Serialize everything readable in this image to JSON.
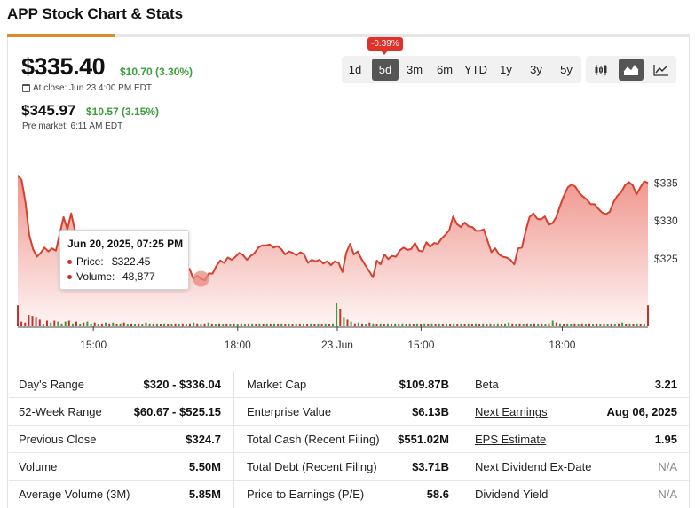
{
  "page": {
    "title": "APP Stock Chart & Stats"
  },
  "quote": {
    "price": "$335.40",
    "change": "$10.70 (3.30%)",
    "close_label": "At close: Jun 23 4:00 PM EDT",
    "pre_price": "$345.97",
    "pre_change": "$10.57 (3.15%)",
    "pre_label": "Pre market: 6:11 AM EDT"
  },
  "range_tabs": [
    {
      "label": "1d",
      "active": false
    },
    {
      "label": "5d",
      "active": true
    },
    {
      "label": "3m",
      "active": false
    },
    {
      "label": "6m",
      "active": false
    },
    {
      "label": "YTD",
      "active": false
    },
    {
      "label": "1y",
      "active": false
    },
    {
      "label": "3y",
      "active": false
    },
    {
      "label": "5y",
      "active": false
    }
  ],
  "range_badge": "-0.39%",
  "chart_types": [
    {
      "icon": "candlestick-icon",
      "active": false
    },
    {
      "icon": "area-chart-icon",
      "active": true
    },
    {
      "icon": "line-chart-icon",
      "active": false
    }
  ],
  "chart_data": {
    "type": "area",
    "colors": {
      "line": "#d6402f",
      "fill": "#e65345",
      "volume_up": "#3a9b3a",
      "volume_down": "#c9302c"
    },
    "ylim": [
      318.5,
      336.2
    ],
    "y_ticks": [
      325,
      330,
      335
    ],
    "y_tick_labels": [
      "$325",
      "$330",
      "$335"
    ],
    "x_tick_labels": [
      "15:00",
      "18:00",
      "23 Jun",
      "15:00",
      "18:00"
    ],
    "x_tick_positions": [
      0.12,
      0.349,
      0.507,
      0.64,
      0.864
    ],
    "grid": false,
    "price": [
      336.0,
      335.4,
      332.5,
      328.2,
      326.3,
      325.3,
      325.8,
      326.5,
      326.0,
      326.4,
      326.1,
      328.3,
      330.5,
      328.9,
      331.0,
      328.7,
      325.7,
      325.3,
      325.2,
      325.1,
      324.9,
      325.6,
      325.4,
      325.5,
      324.6,
      325.8,
      323.7,
      324.7,
      324.8,
      323.6,
      325.3,
      323.6,
      323.3,
      324.6,
      323.8,
      323.3,
      324.4,
      323.8,
      323.0,
      323.9,
      324.4,
      323.7,
      323.3,
      323.9,
      323.3,
      323.7,
      322.4,
      322.8,
      322.4,
      322.2,
      323.1,
      323.1,
      324.1,
      324.8,
      324.5,
      325.2,
      324.9,
      325.3,
      325.8,
      325.5,
      324.9,
      325.4,
      325.8,
      326.5,
      326.8,
      326.8,
      326.9,
      326.5,
      326.7,
      326.3,
      325.6,
      326.0,
      325.8,
      325.5,
      325.9,
      325.6,
      324.5,
      324.9,
      324.7,
      324.9,
      324.4,
      324.7,
      324.2,
      324.7,
      324.5,
      323.3,
      325.8,
      327.0,
      325.6,
      326.0,
      325.0,
      324.2,
      323.4,
      322.6,
      324.8,
      324.3,
      325.6,
      325.0,
      325.4,
      325.3,
      326.1,
      326.5,
      326.2,
      326.3,
      327.1,
      326.1,
      326.0,
      327.2,
      326.6,
      327.1,
      327.0,
      327.7,
      328.2,
      328.8,
      330.6,
      329.6,
      329.2,
      329.8,
      329.3,
      329.2,
      328.7,
      328.7,
      328.9,
      327.4,
      325.9,
      326.4,
      325.6,
      325.3,
      325.2,
      324.9,
      324.3,
      326.4,
      326.5,
      328.7,
      330.5,
      331.0,
      330.3,
      330.2,
      330.6,
      329.5,
      329.7,
      330.5,
      332.0,
      333.3,
      334.4,
      334.8,
      334.5,
      333.7,
      333.2,
      332.8,
      332.2,
      332.2,
      331.6,
      331.1,
      330.9,
      331.2,
      332.5,
      333.3,
      333.8,
      334.7,
      335.1,
      334.7,
      333.5,
      334.4,
      335.2,
      335.0
    ],
    "volume": [
      22,
      5,
      4,
      12,
      11,
      9,
      7,
      2,
      6,
      4,
      6,
      5,
      3,
      5,
      6,
      3,
      5,
      2,
      4,
      5,
      3,
      4,
      2,
      3,
      4,
      3,
      4,
      2,
      3,
      4,
      2,
      3,
      2,
      3,
      2,
      4,
      3,
      2,
      3,
      2,
      3,
      2,
      2,
      3,
      2,
      3,
      2,
      3,
      4,
      3,
      2,
      3,
      4,
      3,
      2,
      3,
      2,
      3,
      2,
      3,
      2,
      3,
      2,
      3,
      3,
      2,
      3,
      2,
      3,
      2,
      3,
      2,
      3,
      2,
      3,
      2,
      3,
      2,
      3,
      2,
      3,
      2,
      3,
      2,
      3,
      2,
      3,
      24,
      18,
      9,
      7,
      5,
      3,
      4,
      3,
      2,
      4,
      3,
      2,
      3,
      2,
      3,
      2,
      3,
      2,
      3,
      2,
      3,
      2,
      3,
      2,
      3,
      2,
      3,
      2,
      3,
      2,
      3,
      2,
      3,
      2,
      3,
      2,
      3,
      2,
      3,
      2,
      3,
      2,
      3,
      2,
      3,
      2,
      3,
      4,
      3,
      2,
      3,
      2,
      3,
      2,
      3,
      2,
      3,
      2,
      3,
      6,
      4,
      3,
      2,
      3,
      2,
      3,
      2,
      3,
      2,
      3,
      2,
      3,
      2,
      3,
      2,
      3,
      2,
      3,
      4,
      2,
      3,
      2,
      3,
      2,
      3,
      22
    ],
    "volume_up": [
      false,
      false,
      false,
      false,
      false,
      false,
      false,
      true,
      false,
      true,
      false,
      true,
      true,
      true,
      false,
      true,
      false,
      true,
      false,
      true,
      true,
      false,
      true,
      false,
      true,
      false,
      true,
      false,
      true,
      false,
      true,
      false,
      true,
      false,
      true,
      false,
      true,
      false,
      true,
      false,
      true,
      false,
      true,
      false,
      true,
      false,
      true,
      false,
      true,
      false,
      true,
      false,
      true,
      false,
      true,
      false,
      true,
      false,
      true,
      false,
      true,
      false,
      true,
      false,
      true,
      false,
      true,
      false,
      true,
      false,
      true,
      false,
      true,
      false,
      true,
      false,
      true,
      false,
      true,
      false,
      true,
      false,
      true,
      false,
      true,
      false,
      true,
      true,
      false,
      true,
      false,
      true,
      false,
      true,
      false,
      true,
      false,
      true,
      false,
      true,
      false,
      true,
      false,
      true,
      false,
      true,
      false,
      true,
      false,
      true,
      false,
      true,
      false,
      true,
      false,
      true,
      false,
      true,
      false,
      true,
      false,
      true,
      false,
      true,
      false,
      true,
      false,
      true,
      false,
      true,
      false,
      true,
      false,
      true,
      true,
      false,
      true,
      false,
      true,
      false,
      true,
      false,
      true,
      false,
      true,
      false,
      true,
      false,
      true,
      false,
      true,
      true,
      false,
      true,
      false,
      true,
      false,
      true,
      false,
      true,
      false,
      true,
      false,
      true,
      false,
      true,
      false,
      true,
      false,
      true,
      false,
      true,
      false,
      true,
      true
    ],
    "highlight_index": 48,
    "tooltip": {
      "date": "Jun 20, 2025, 07:25 PM",
      "price_label": "Price:",
      "price": "$322.45",
      "volume_label": "Volume:",
      "volume": "48,877"
    }
  },
  "stats": {
    "col1": [
      {
        "label": "Day's Range",
        "value": "$320 - $336.04"
      },
      {
        "label": "52-Week Range",
        "value": "$60.67 - $525.15"
      },
      {
        "label": "Previous Close",
        "value": "$324.7"
      },
      {
        "label": "Volume",
        "value": "5.50M"
      },
      {
        "label": "Average Volume (3M)",
        "value": "5.85M"
      }
    ],
    "col2": [
      {
        "label": "Market Cap",
        "value": "$109.87B"
      },
      {
        "label": "Enterprise Value",
        "value": "$6.13B"
      },
      {
        "label": "Total Cash (Recent Filing)",
        "value": "$551.02M"
      },
      {
        "label": "Total Debt (Recent Filing)",
        "value": "$3.71B"
      },
      {
        "label": "Price to Earnings (P/E)",
        "value": "58.6"
      }
    ],
    "col3": [
      {
        "label": "Beta",
        "value": "3.21"
      },
      {
        "label": "Next Earnings",
        "value": "Aug 06, 2025"
      },
      {
        "label": "EPS Estimate",
        "value": "1.95"
      },
      {
        "label": "Next Dividend Ex-Date",
        "value": "N/A"
      },
      {
        "label": "Dividend Yield",
        "value": "N/A"
      }
    ]
  }
}
